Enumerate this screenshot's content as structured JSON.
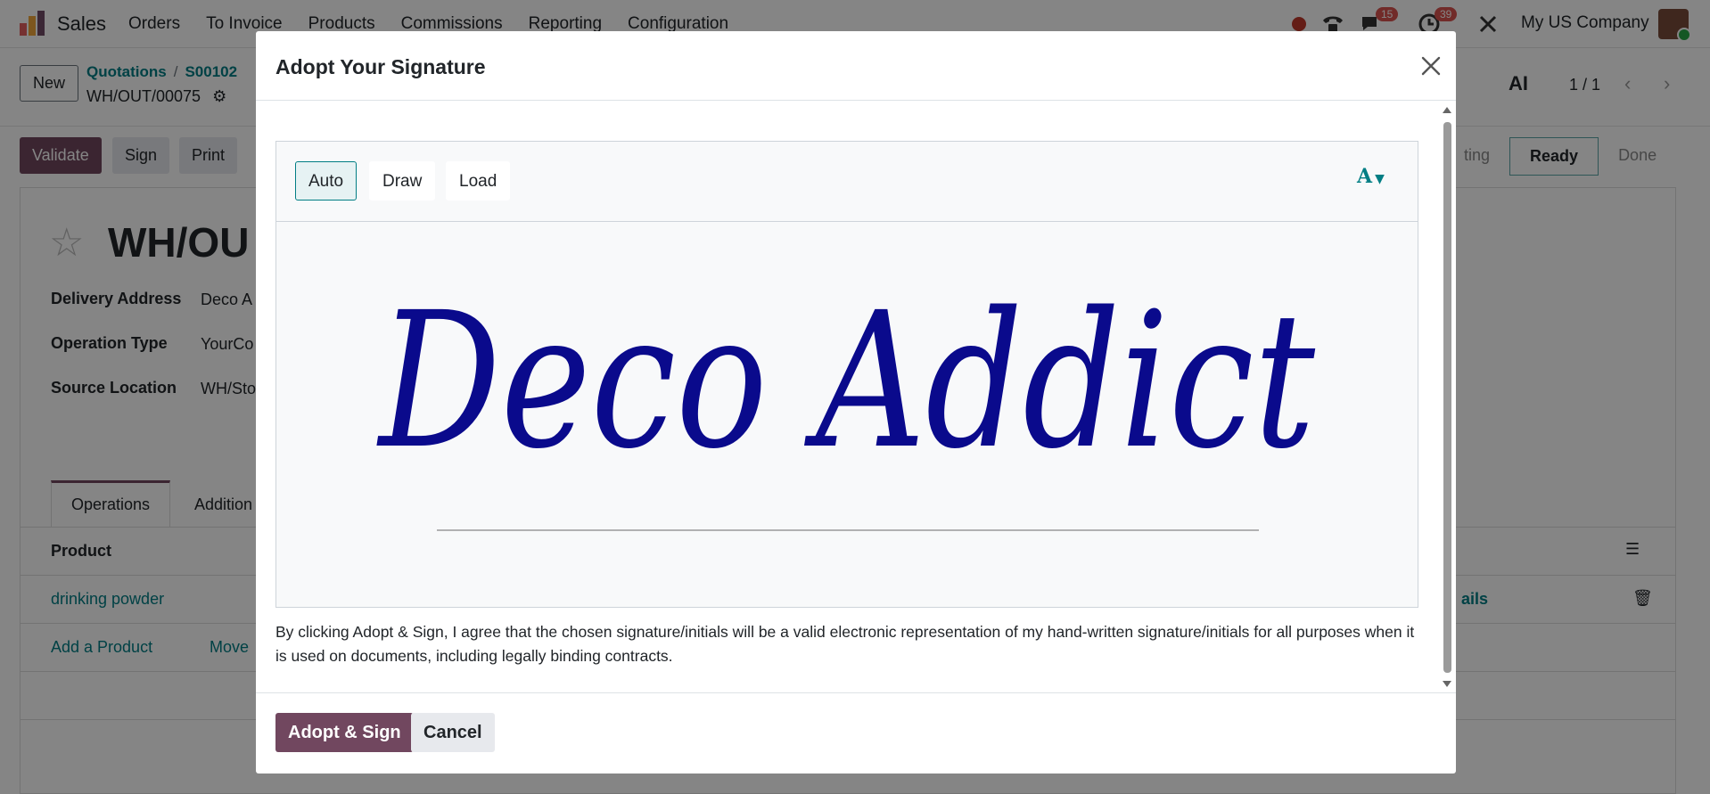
{
  "topbar": {
    "app_name": "Sales",
    "menu": [
      "Orders",
      "To Invoice",
      "Products",
      "Commissions",
      "Reporting",
      "Configuration"
    ],
    "messages_count": "15",
    "activities_count": "39",
    "company": "My US Company"
  },
  "control": {
    "new_label": "New",
    "breadcrumb": [
      "Quotations",
      "S00102"
    ],
    "record_name": "WH/OUT/00075",
    "pager": "1 / 1"
  },
  "statusbar": {
    "validate_label": "Validate",
    "sign_label": "Sign",
    "print_label": "Print",
    "steps": [
      "ting",
      "Ready",
      "Done"
    ]
  },
  "form": {
    "title": "WH/OU",
    "fields": [
      {
        "label": "Delivery Address",
        "value": "Deco A"
      },
      {
        "label": "Operation Type",
        "value": "YourCo"
      },
      {
        "label": "Source Location",
        "value": "WH/Sto"
      }
    ],
    "tabs": [
      "Operations",
      "Addition"
    ],
    "table_header": "Product",
    "product_row": "drinking powder",
    "details_fragment": "ails",
    "add_product": "Add a Product",
    "move_fragment": "Move"
  },
  "dialog": {
    "title": "Adopt Your Signature",
    "modes": [
      "Auto",
      "Draw",
      "Load"
    ],
    "font_button": "A",
    "signature_text": "Deco Addict",
    "signature_color": "#0a0a8c",
    "legal_text": "By clicking Adopt & Sign, I agree that the chosen signature/initials will be a valid electronic representation of my hand-written signature/initials for all purposes when it is used on documents, including legally binding contracts.",
    "adopt_label": "Adopt & Sign",
    "cancel_label": "Cancel"
  },
  "colors": {
    "primary": "#71475f",
    "link": "#017e84"
  }
}
